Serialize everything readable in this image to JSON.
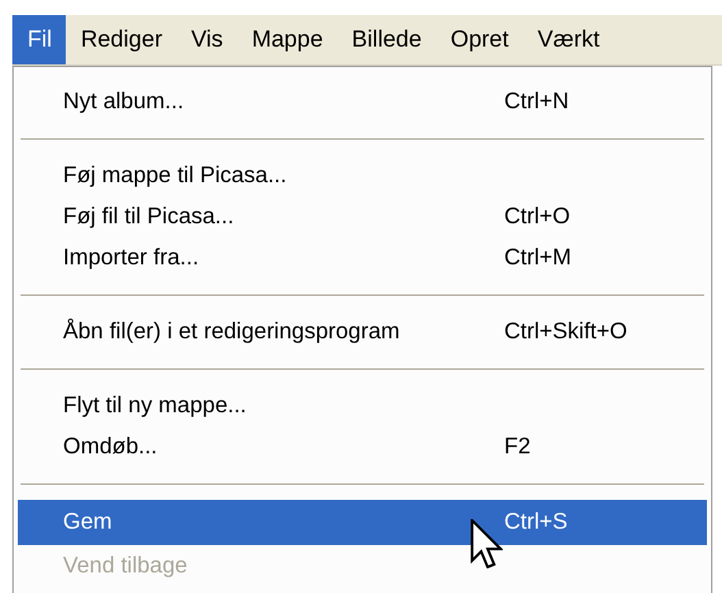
{
  "menu_bar": {
    "items": [
      {
        "label": "Fil",
        "selected": true
      },
      {
        "label": "Rediger",
        "selected": false
      },
      {
        "label": "Vis",
        "selected": false
      },
      {
        "label": "Mappe",
        "selected": false
      },
      {
        "label": "Billede",
        "selected": false
      },
      {
        "label": "Opret",
        "selected": false
      },
      {
        "label": "Værkt",
        "selected": false
      }
    ]
  },
  "menu": {
    "items": [
      {
        "kind": "item",
        "label": "Nyt album...",
        "shortcut": "Ctrl+N",
        "selected": false,
        "disabled": false
      },
      {
        "kind": "separator"
      },
      {
        "kind": "item",
        "label": "Føj mappe til Picasa...",
        "selected": false,
        "disabled": false
      },
      {
        "kind": "item",
        "label": "Føj fil til Picasa...",
        "shortcut": "Ctrl+O",
        "selected": false,
        "disabled": false
      },
      {
        "kind": "item",
        "label": "Importer fra...",
        "shortcut": "Ctrl+M",
        "selected": false,
        "disabled": false
      },
      {
        "kind": "separator"
      },
      {
        "kind": "item",
        "label": "Åbn fil(er) i et redigeringsprogram",
        "shortcut": "Ctrl+Skift+O",
        "selected": false,
        "disabled": false
      },
      {
        "kind": "separator"
      },
      {
        "kind": "item",
        "label": "Flyt til ny mappe...",
        "selected": false,
        "disabled": false
      },
      {
        "kind": "item",
        "label": "Omdøb...",
        "shortcut": "F2",
        "selected": false,
        "disabled": false
      },
      {
        "kind": "separator"
      },
      {
        "kind": "item",
        "label": "Gem",
        "shortcut": "Ctrl+S",
        "selected": true,
        "disabled": false
      },
      {
        "kind": "item",
        "label": "Vend tilbage",
        "selected": false,
        "disabled": true
      }
    ]
  }
}
